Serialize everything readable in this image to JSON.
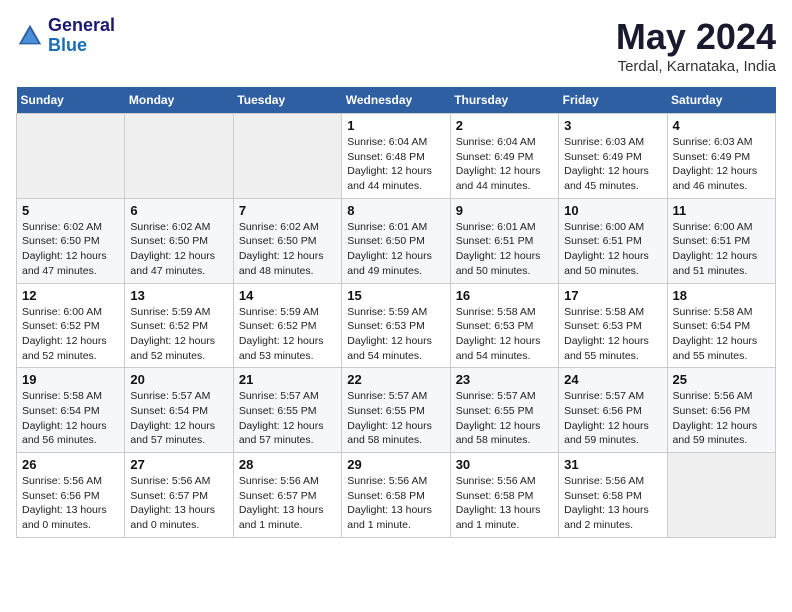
{
  "header": {
    "logo_line1": "General",
    "logo_line2": "Blue",
    "title": "May 2024",
    "subtitle": "Terdal, Karnataka, India"
  },
  "days_of_week": [
    "Sunday",
    "Monday",
    "Tuesday",
    "Wednesday",
    "Thursday",
    "Friday",
    "Saturday"
  ],
  "weeks": [
    [
      {
        "day": "",
        "info": ""
      },
      {
        "day": "",
        "info": ""
      },
      {
        "day": "",
        "info": ""
      },
      {
        "day": "1",
        "info": "Sunrise: 6:04 AM\nSunset: 6:48 PM\nDaylight: 12 hours\nand 44 minutes."
      },
      {
        "day": "2",
        "info": "Sunrise: 6:04 AM\nSunset: 6:49 PM\nDaylight: 12 hours\nand 44 minutes."
      },
      {
        "day": "3",
        "info": "Sunrise: 6:03 AM\nSunset: 6:49 PM\nDaylight: 12 hours\nand 45 minutes."
      },
      {
        "day": "4",
        "info": "Sunrise: 6:03 AM\nSunset: 6:49 PM\nDaylight: 12 hours\nand 46 minutes."
      }
    ],
    [
      {
        "day": "5",
        "info": "Sunrise: 6:02 AM\nSunset: 6:50 PM\nDaylight: 12 hours\nand 47 minutes."
      },
      {
        "day": "6",
        "info": "Sunrise: 6:02 AM\nSunset: 6:50 PM\nDaylight: 12 hours\nand 47 minutes."
      },
      {
        "day": "7",
        "info": "Sunrise: 6:02 AM\nSunset: 6:50 PM\nDaylight: 12 hours\nand 48 minutes."
      },
      {
        "day": "8",
        "info": "Sunrise: 6:01 AM\nSunset: 6:50 PM\nDaylight: 12 hours\nand 49 minutes."
      },
      {
        "day": "9",
        "info": "Sunrise: 6:01 AM\nSunset: 6:51 PM\nDaylight: 12 hours\nand 50 minutes."
      },
      {
        "day": "10",
        "info": "Sunrise: 6:00 AM\nSunset: 6:51 PM\nDaylight: 12 hours\nand 50 minutes."
      },
      {
        "day": "11",
        "info": "Sunrise: 6:00 AM\nSunset: 6:51 PM\nDaylight: 12 hours\nand 51 minutes."
      }
    ],
    [
      {
        "day": "12",
        "info": "Sunrise: 6:00 AM\nSunset: 6:52 PM\nDaylight: 12 hours\nand 52 minutes."
      },
      {
        "day": "13",
        "info": "Sunrise: 5:59 AM\nSunset: 6:52 PM\nDaylight: 12 hours\nand 52 minutes."
      },
      {
        "day": "14",
        "info": "Sunrise: 5:59 AM\nSunset: 6:52 PM\nDaylight: 12 hours\nand 53 minutes."
      },
      {
        "day": "15",
        "info": "Sunrise: 5:59 AM\nSunset: 6:53 PM\nDaylight: 12 hours\nand 54 minutes."
      },
      {
        "day": "16",
        "info": "Sunrise: 5:58 AM\nSunset: 6:53 PM\nDaylight: 12 hours\nand 54 minutes."
      },
      {
        "day": "17",
        "info": "Sunrise: 5:58 AM\nSunset: 6:53 PM\nDaylight: 12 hours\nand 55 minutes."
      },
      {
        "day": "18",
        "info": "Sunrise: 5:58 AM\nSunset: 6:54 PM\nDaylight: 12 hours\nand 55 minutes."
      }
    ],
    [
      {
        "day": "19",
        "info": "Sunrise: 5:58 AM\nSunset: 6:54 PM\nDaylight: 12 hours\nand 56 minutes."
      },
      {
        "day": "20",
        "info": "Sunrise: 5:57 AM\nSunset: 6:54 PM\nDaylight: 12 hours\nand 57 minutes."
      },
      {
        "day": "21",
        "info": "Sunrise: 5:57 AM\nSunset: 6:55 PM\nDaylight: 12 hours\nand 57 minutes."
      },
      {
        "day": "22",
        "info": "Sunrise: 5:57 AM\nSunset: 6:55 PM\nDaylight: 12 hours\nand 58 minutes."
      },
      {
        "day": "23",
        "info": "Sunrise: 5:57 AM\nSunset: 6:55 PM\nDaylight: 12 hours\nand 58 minutes."
      },
      {
        "day": "24",
        "info": "Sunrise: 5:57 AM\nSunset: 6:56 PM\nDaylight: 12 hours\nand 59 minutes."
      },
      {
        "day": "25",
        "info": "Sunrise: 5:56 AM\nSunset: 6:56 PM\nDaylight: 12 hours\nand 59 minutes."
      }
    ],
    [
      {
        "day": "26",
        "info": "Sunrise: 5:56 AM\nSunset: 6:56 PM\nDaylight: 13 hours\nand 0 minutes."
      },
      {
        "day": "27",
        "info": "Sunrise: 5:56 AM\nSunset: 6:57 PM\nDaylight: 13 hours\nand 0 minutes."
      },
      {
        "day": "28",
        "info": "Sunrise: 5:56 AM\nSunset: 6:57 PM\nDaylight: 13 hours\nand 1 minute."
      },
      {
        "day": "29",
        "info": "Sunrise: 5:56 AM\nSunset: 6:58 PM\nDaylight: 13 hours\nand 1 minute."
      },
      {
        "day": "30",
        "info": "Sunrise: 5:56 AM\nSunset: 6:58 PM\nDaylight: 13 hours\nand 1 minute."
      },
      {
        "day": "31",
        "info": "Sunrise: 5:56 AM\nSunset: 6:58 PM\nDaylight: 13 hours\nand 2 minutes."
      },
      {
        "day": "",
        "info": ""
      }
    ]
  ]
}
